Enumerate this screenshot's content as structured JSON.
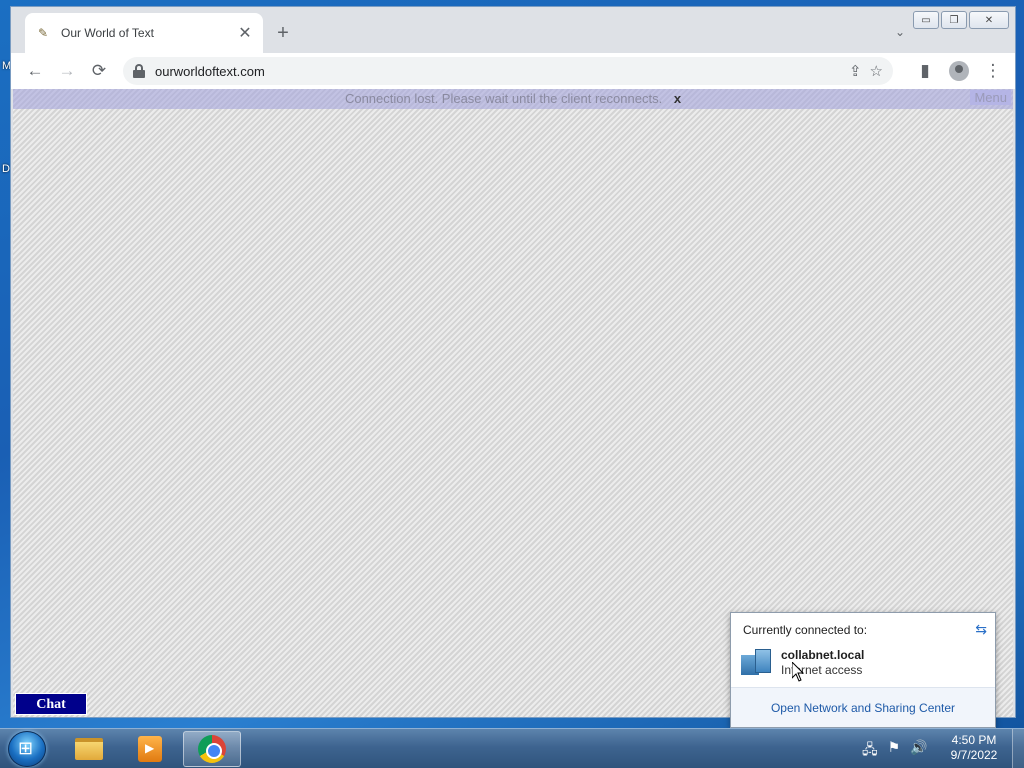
{
  "desktop": {
    "letters": [
      "M",
      "D"
    ]
  },
  "browser": {
    "tab": {
      "title": "Our World of Text",
      "close": "✕"
    },
    "new_tab": "+",
    "tab_list": "⌄",
    "window_controls": {
      "minimize": "▭",
      "maximize": "❐",
      "close": "✕"
    },
    "nav": {
      "back": "←",
      "forward": "→",
      "reload": "⟳"
    },
    "url": "ourworldoftext.com",
    "omni_icons": {
      "share": "⇪",
      "bookmark": "☆"
    },
    "side_panel": "▮",
    "more": "⋮"
  },
  "page": {
    "banner": "Connection lost. Please wait until the client reconnects.",
    "banner_close": "x",
    "menu_label": "Menu",
    "chat_label": "Chat"
  },
  "network_flyout": {
    "heading": "Currently connected to:",
    "refresh": "⇆",
    "network_name": "collabnet.local",
    "network_status": "Internet access",
    "link": "Open Network and Sharing Center"
  },
  "taskbar": {
    "time": "4:50 PM",
    "date": "9/7/2022",
    "tray_icons": {
      "network": "🖧",
      "action_center": "⚑",
      "volume": "🔊"
    }
  }
}
